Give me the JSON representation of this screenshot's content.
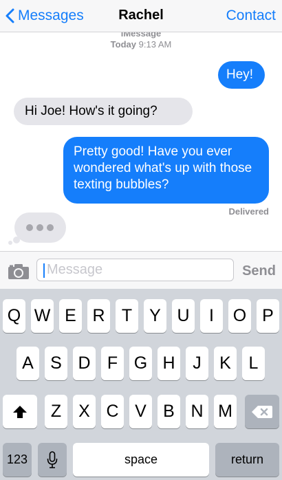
{
  "nav": {
    "back_label": "Messages",
    "title": "Rachel",
    "contact_label": "Contact"
  },
  "conversation": {
    "service_label": "iMessage",
    "timestamp_day": "Today",
    "timestamp_time": "9:13 AM",
    "messages": [
      {
        "direction": "outgoing",
        "text": "Hey!"
      },
      {
        "direction": "incoming",
        "text": "Hi Joe! How's it going?"
      },
      {
        "direction": "outgoing",
        "text": "Pretty good! Have you ever wondered what's up with those texting bubbles?"
      }
    ],
    "delivery_status": "Delivered",
    "typing_indicator": "typing-dots"
  },
  "input_bar": {
    "camera_icon": "camera-icon",
    "placeholder": "Message",
    "send_label": "Send"
  },
  "keyboard": {
    "row1": [
      "Q",
      "W",
      "E",
      "R",
      "T",
      "Y",
      "U",
      "I",
      "O",
      "P"
    ],
    "row2": [
      "A",
      "S",
      "D",
      "F",
      "G",
      "H",
      "J",
      "K",
      "L"
    ],
    "row3": [
      "Z",
      "X",
      "C",
      "V",
      "B",
      "N",
      "M"
    ],
    "shift_icon": "shift-arrow-icon",
    "delete_icon": "backspace-icon",
    "numbers_label": "123",
    "mic_icon": "microphone-icon",
    "space_label": "space",
    "return_label": "return"
  },
  "colors": {
    "accent": "#157efb",
    "incoming_bubble": "#e5e5ea",
    "keyboard_bg": "#d1d5db",
    "special_key": "#adb3bc"
  }
}
